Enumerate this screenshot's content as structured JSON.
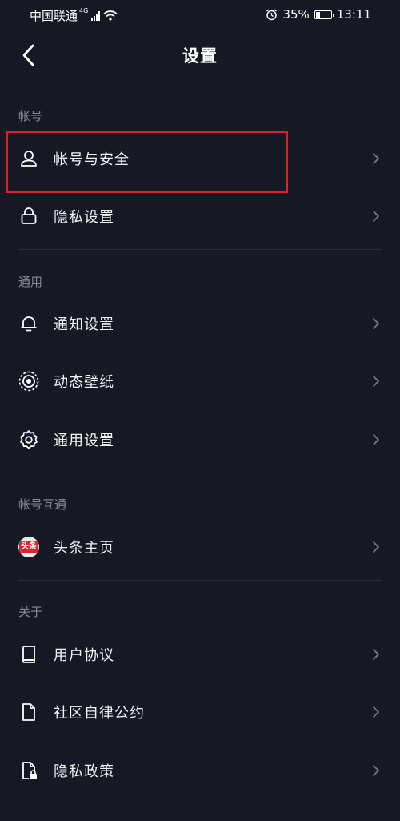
{
  "status_bar": {
    "carrier": "中国联通",
    "network": "4G",
    "battery": "35%",
    "battery_level": 0.35,
    "time": "13:11"
  },
  "header": {
    "title": "设置",
    "back_icon": "chevron-left-icon"
  },
  "sections": {
    "account": {
      "label": "帐号",
      "items": [
        {
          "label": "帐号与安全",
          "icon": "user-icon"
        },
        {
          "label": "隐私设置",
          "icon": "lock-icon"
        }
      ]
    },
    "general": {
      "label": "通用",
      "items": [
        {
          "label": "通知设置",
          "icon": "bell-icon"
        },
        {
          "label": "动态壁纸",
          "icon": "live-wallpaper-icon"
        },
        {
          "label": "通用设置",
          "icon": "gear-icon"
        }
      ]
    },
    "linked": {
      "label": "帐号互通",
      "items": [
        {
          "label": "头条主页",
          "icon": "toutiao-icon",
          "icon_text": "头条"
        }
      ]
    },
    "about": {
      "label": "关于",
      "items": [
        {
          "label": "用户协议",
          "icon": "book-icon"
        },
        {
          "label": "社区自律公约",
          "icon": "document-icon"
        },
        {
          "label": "隐私政策",
          "icon": "privacy-document-icon"
        }
      ]
    }
  },
  "colors": {
    "background": "#161823",
    "section_label": "#8a8b91",
    "highlight_border": "#d7232f",
    "divider": "#2b2d37"
  }
}
